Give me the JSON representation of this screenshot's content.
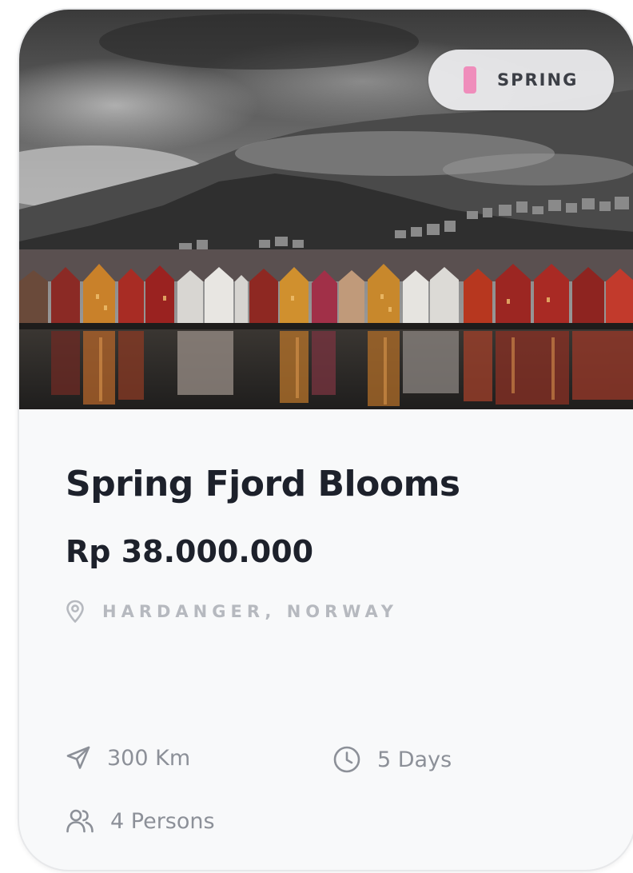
{
  "tour": {
    "season": "SPRING",
    "title": "Spring Fjord Blooms",
    "price": "Rp 38.000.000",
    "location": "HARDANGER, NORWAY",
    "stats": {
      "distance": "300 Km",
      "duration": "5 Days",
      "persons": "4 Persons"
    }
  },
  "icons": {
    "location": "map-pin-icon",
    "distance": "navigation-arrow-icon",
    "duration": "clock-icon",
    "persons": "users-icon"
  },
  "colors": {
    "season_accent": "#ef8dbb",
    "title": "#1d212b",
    "muted": "#8c9098",
    "card_bg": "#f8f9fa"
  }
}
